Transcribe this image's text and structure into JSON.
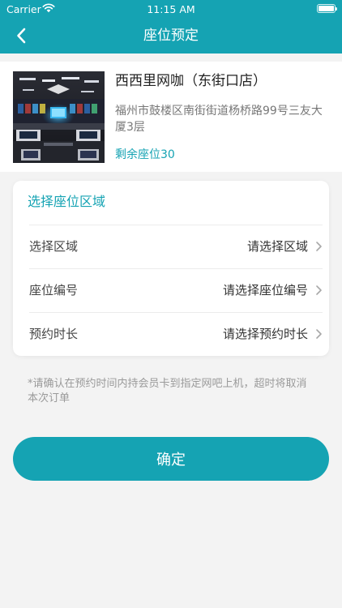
{
  "status_bar": {
    "carrier": "Carrier",
    "time": "11:15 AM"
  },
  "header": {
    "title": "座位预定",
    "back_icon": "chevron-left-icon"
  },
  "store": {
    "name": "西西里网咖（东街口店）",
    "address": "福州市鼓楼区南街街道杨桥路99号三友大厦3层",
    "seats_remaining": "剩余座位30",
    "image": "internet-cafe-photo"
  },
  "select_section": {
    "title": "选择座位区域",
    "rows": [
      {
        "label": "选择区域",
        "value": "请选择区域"
      },
      {
        "label": "座位编号",
        "value": "请选择座位编号"
      },
      {
        "label": "预约时长",
        "value": "请选择预约时长"
      }
    ]
  },
  "notice": "*请确认在预约时间内持会员卡到指定网吧上机，超时将取消本次订单",
  "confirm_label": "确定",
  "colors": {
    "accent": "#15a3b3",
    "background": "#f3f3f3"
  }
}
